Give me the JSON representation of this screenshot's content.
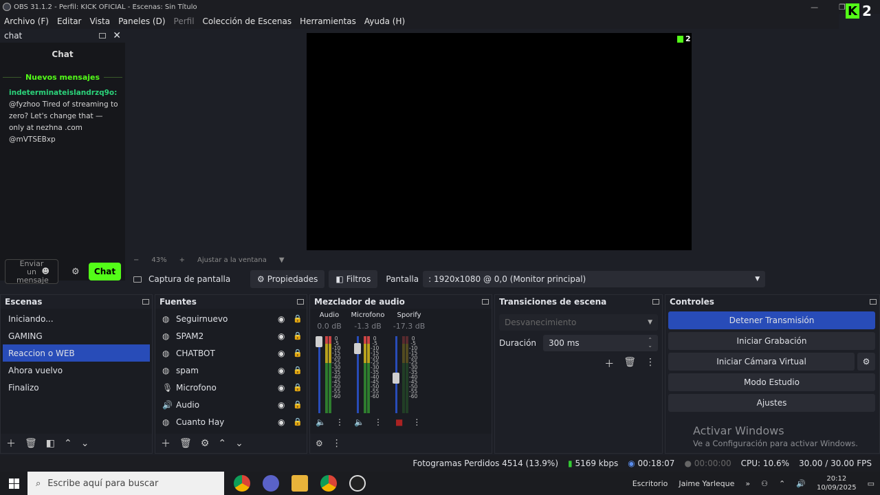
{
  "window": {
    "title": "OBS 31.1.2 - Perfil: KICK OFICIAL - Escenas: Sin Título",
    "badge": "2"
  },
  "menu": [
    {
      "label": "Archivo (F)",
      "enabled": true
    },
    {
      "label": "Editar",
      "enabled": true
    },
    {
      "label": "Vista",
      "enabled": true
    },
    {
      "label": "Paneles (D)",
      "enabled": true
    },
    {
      "label": "Perfil",
      "enabled": false
    },
    {
      "label": "Colección de Escenas",
      "enabled": true
    },
    {
      "label": "Herramientas",
      "enabled": true
    },
    {
      "label": "Ayuda (H)",
      "enabled": true
    }
  ],
  "chat": {
    "dock_title": "chat",
    "title": "Chat",
    "new_messages": "Nuevos mensajes",
    "message": {
      "user": "indeterminateislandrzq9o:",
      "text": "@fyzhoo Tired of streaming to zero? Let's change that — only at nezhna .com @mVTSEBxp"
    },
    "input_placeholder": "Enviar un mensaje",
    "send_label": "Chat"
  },
  "preview": {
    "badge": "2",
    "zoom_label": "43%",
    "fit_label": "Ajustar a la ventana"
  },
  "source_bar": {
    "source": "Captura de pantalla",
    "properties": "Propiedades",
    "filters": "Filtros",
    "display_label": "Pantalla",
    "display_value": ": 1920x1080 @ 0,0 (Monitor principal)"
  },
  "scenes": {
    "title": "Escenas",
    "items": [
      "Iniciando...",
      "GAMING",
      "Reaccion o WEB",
      "Ahora vuelvo",
      "Finalizo"
    ],
    "selected": 2
  },
  "sources": {
    "title": "Fuentes",
    "items": [
      {
        "name": "Seguirnuevo",
        "icon": "globe-icon"
      },
      {
        "name": "SPAM2",
        "icon": "globe-icon"
      },
      {
        "name": "CHATBOT",
        "icon": "globe-icon"
      },
      {
        "name": "spam",
        "icon": "globe-icon"
      },
      {
        "name": "Microfono",
        "icon": "mic-icon"
      },
      {
        "name": "Audio",
        "icon": "speaker-icon"
      },
      {
        "name": "Cuanto Hay",
        "icon": "globe-icon"
      }
    ]
  },
  "mixer": {
    "title": "Mezclador de audio",
    "channels": [
      {
        "name": "Audio",
        "db": "0.0 dB",
        "level": 1.0
      },
      {
        "name": "Microfono",
        "db": "-1.3 dB",
        "level": 0.9
      },
      {
        "name": "Sporify",
        "db": "-17.3 dB",
        "level": 0.45
      }
    ],
    "scale": [
      "0",
      "-5",
      "-10",
      "-15",
      "-20",
      "-25",
      "-30",
      "-35",
      "-40",
      "-45",
      "-50",
      "-55",
      "-60"
    ]
  },
  "transitions": {
    "title": "Transiciones de escena",
    "selected": "Desvanecimiento",
    "duration_label": "Duración",
    "duration_value": "300 ms"
  },
  "controls": {
    "title": "Controles",
    "buttons": [
      "Detener Transmisión",
      "Iniciar Grabación",
      "Iniciar Cámara Virtual",
      "Modo Estudio",
      "Ajustes"
    ]
  },
  "activate": {
    "title": "Activar Windows",
    "subtitle": "Ve a Configuración para activar Windows."
  },
  "status": {
    "dropped": "Fotogramas Perdidos 4514 (13.9%)",
    "bitrate": "5169 kbps",
    "stream_time": "00:18:07",
    "rec_time": "00:00:00",
    "cpu": "CPU: 10.6%",
    "fps": "30.00 / 30.00 FPS"
  },
  "taskbar": {
    "search_placeholder": "Escribe aquí para buscar",
    "desktop": "Escritorio",
    "user": "Jaime Yarleque",
    "time": "20:12",
    "date": "10/09/2025",
    "chevrons": "»"
  },
  "colors": {
    "accent": "#284cb8",
    "kick_green": "#53fc18"
  }
}
